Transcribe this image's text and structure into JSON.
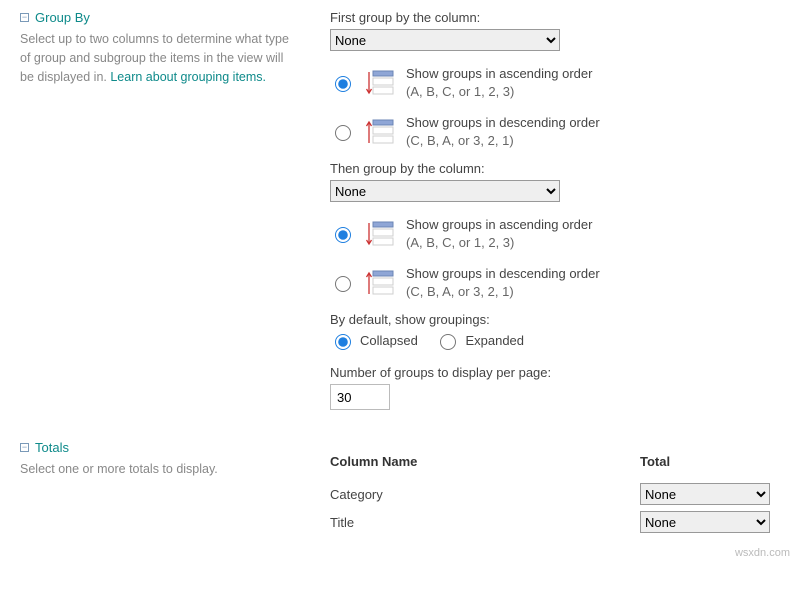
{
  "groupBy": {
    "title": "Group By",
    "description_a": "Select up to two columns to determine what type of group and subgroup the items in the view will be displayed in. ",
    "description_link": "Learn about grouping items.",
    "first_label": "First group by the column:",
    "first_select": "None",
    "then_label": "Then group by the column:",
    "then_select": "None",
    "asc_line1": "Show groups in ascending order",
    "asc_line2": "(A, B, C, or 1, 2, 3)",
    "desc_line1": "Show groups in descending order",
    "desc_line2": "(C, B, A, or 3, 2, 1)",
    "default_label": "By default, show groupings:",
    "collapsed": "Collapsed",
    "expanded": "Expanded",
    "perpage_label": "Number of groups to display per page:",
    "perpage_value": "30"
  },
  "totals": {
    "title": "Totals",
    "description": "Select one or more totals to display.",
    "col_header": "Column Name",
    "total_header": "Total",
    "rows": {
      "0": {
        "name": "Category",
        "value": "None"
      },
      "1": {
        "name": "Title",
        "value": "None"
      }
    }
  },
  "watermark": "wsxdn.com"
}
